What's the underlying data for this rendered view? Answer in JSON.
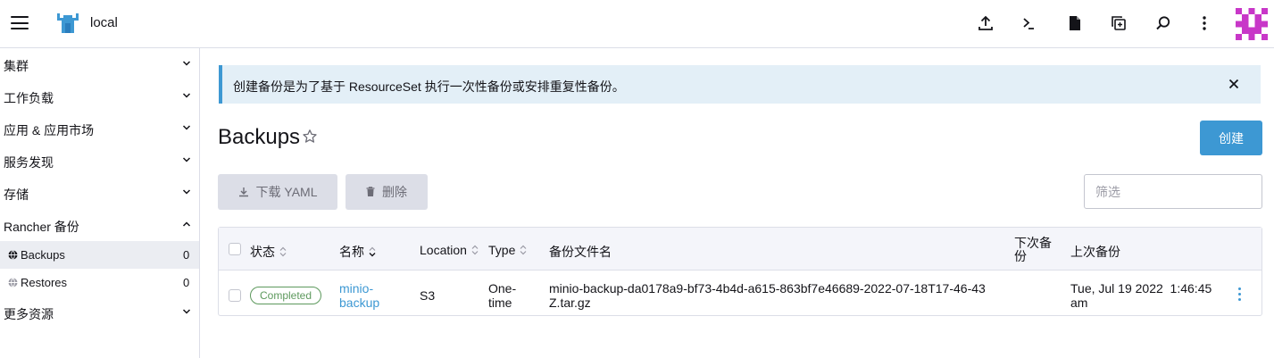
{
  "header": {
    "cluster_name": "local",
    "icons": [
      "menu-icon",
      "rancher-logo",
      "upload-icon",
      "terminal-icon",
      "file-icon",
      "copy-config-icon",
      "search-icon",
      "more-vertical-icon",
      "avatar"
    ]
  },
  "sidebar": {
    "groups": [
      {
        "label": "集群"
      },
      {
        "label": "工作负载"
      },
      {
        "label": "应用 & 应用市场"
      },
      {
        "label": "服务发现"
      },
      {
        "label": "存储"
      },
      {
        "label": "Rancher 备份"
      },
      {
        "label": "更多资源"
      }
    ],
    "items": [
      {
        "label": "Backups",
        "count": "0"
      },
      {
        "label": "Restores",
        "count": "0"
      }
    ]
  },
  "banner": {
    "text": "创建备份是为了基于 ResourceSet 执行一次性备份或安排重复性备份。"
  },
  "page": {
    "title": "Backups",
    "create_label": "创建"
  },
  "actions": {
    "download_yaml": "下载 YAML",
    "delete": "删除",
    "filter_placeholder": "筛选"
  },
  "table": {
    "columns": {
      "status": "状态",
      "name": "名称",
      "location": "Location",
      "type": "Type",
      "filename": "备份文件名",
      "next_backup": "下次备份",
      "last_backup": "上次备份"
    },
    "rows": [
      {
        "status": "Completed",
        "name": "minio-backup",
        "location": "S3",
        "type": "One-time",
        "filename": "minio-backup-da0178a9-bf73-4b4d-a615-863bf7e46689-2022-07-18T17-46-43Z.tar.gz",
        "next_backup": "",
        "last_backup": "Tue, Jul 19 2022  1:46:45 am"
      }
    ]
  },
  "colors": {
    "accent": "#3d98d3",
    "banner_bg": "#e3eff7",
    "success": "#5d995d",
    "disabled_btn": "#dcdee7"
  }
}
